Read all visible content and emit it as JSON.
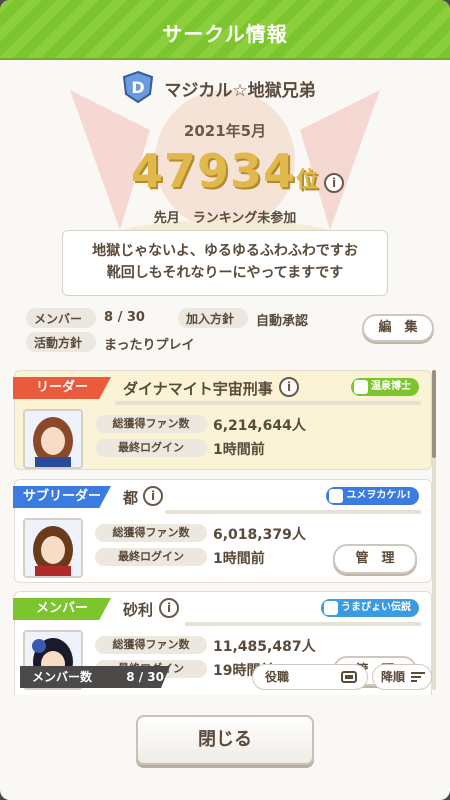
{
  "header": {
    "title": "サークル情報"
  },
  "circle": {
    "name": "マジカル☆地獄兄弟",
    "month": "2021年5月",
    "rank_number": "47934",
    "rank_unit": "位",
    "rank_sub": "先月　ランキング未参加",
    "description_line1": "地獄じゃないよ、ゆるゆるふわふわですお",
    "description_line2": "靴回しもそれなりーにやってますです"
  },
  "info": {
    "member_label": "メンバー",
    "member_value": "8 / 30",
    "join_label": "加入方針",
    "join_value": "自動承認",
    "policy_label": "活動方針",
    "policy_value": "まったりプレイ",
    "edit_button": "編　集"
  },
  "members": [
    {
      "role": "リーダー",
      "role_color": "#ea5a3c",
      "name": "ダイナマイト宇宙刑事",
      "badge": "温泉博士",
      "badge_color": "#7cc52f",
      "fans_label": "総獲得ファン数",
      "fans": "6,214,644人",
      "login_label": "最終ログイン",
      "login": "1時間前"
    },
    {
      "role": "サブリーダー",
      "role_color": "#3c7ce0",
      "name": "都",
      "badge": "ユメヲカケル!",
      "badge_color": "#3c7ce0",
      "fans_label": "総獲得ファン数",
      "fans": "6,018,379人",
      "login_label": "最終ログイン",
      "login": "1時間前",
      "manage": "管　理"
    },
    {
      "role": "メンバー",
      "role_color": "#7cc52f",
      "name": "砂利",
      "badge": "うまぴょい伝説",
      "badge_color": "#3c9ae0",
      "fans_label": "総獲得ファン数",
      "fans": "11,485,487人",
      "login_label": "最終ログイン",
      "login": "19時間前",
      "manage": "管　理"
    }
  ],
  "footer": {
    "member_count_label": "メンバー数",
    "member_count_value": "8 / 30",
    "sort_role": "役職",
    "sort_order": "降順",
    "close": "閉じる"
  }
}
